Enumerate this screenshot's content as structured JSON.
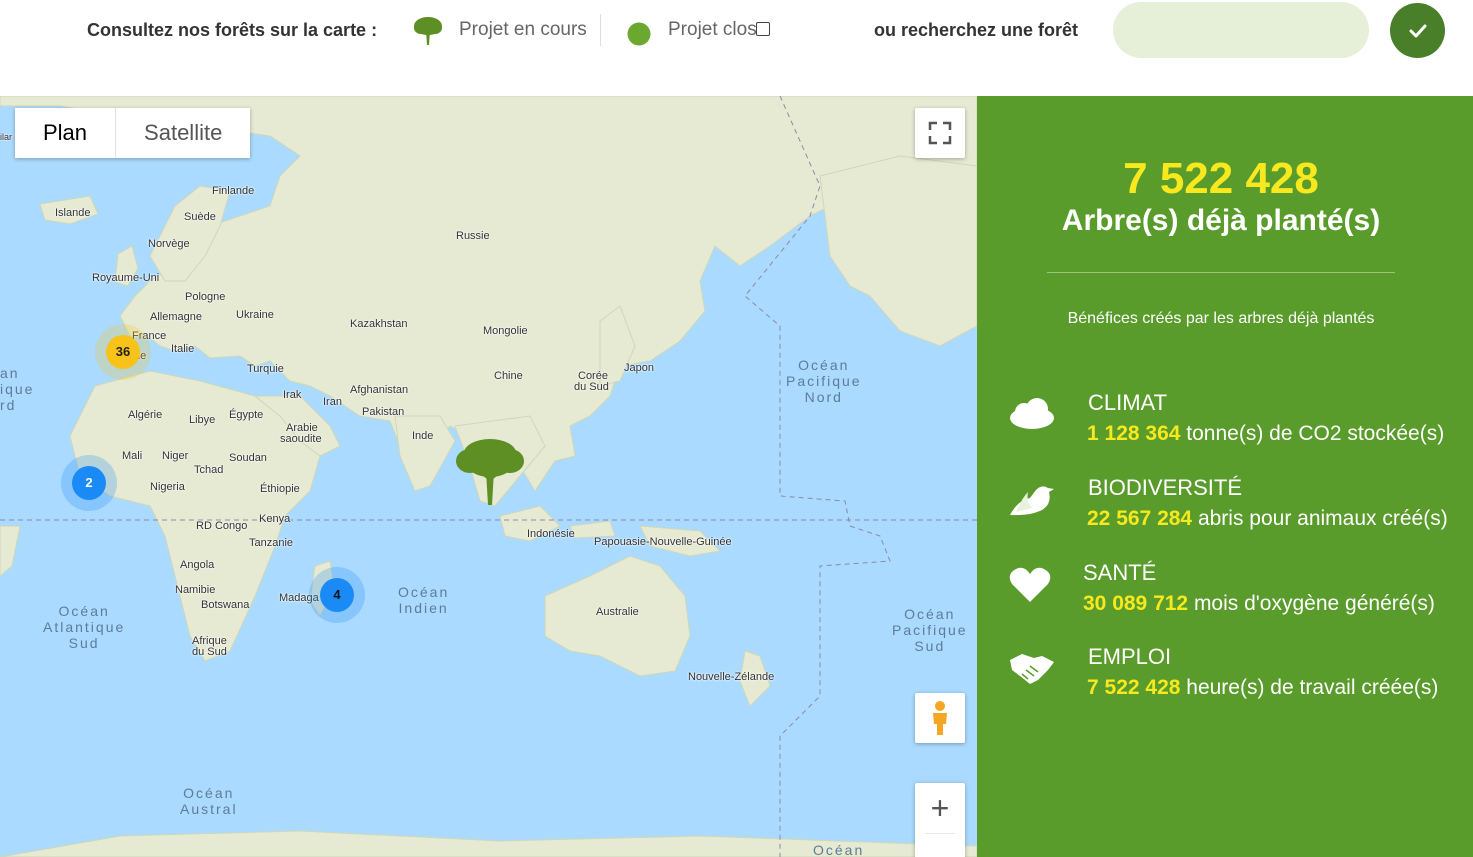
{
  "header": {
    "consult_label": "Consultez nos forêts sur la carte :",
    "legend_current": "Projet en cours",
    "legend_closed": "Projet clos",
    "search_label": "ou recherchez une forêt",
    "search_placeholder": "",
    "search_value": ""
  },
  "map": {
    "type_plan": "Plan",
    "type_satellite": "Satellite",
    "labels": {
      "finlande": "Finlande",
      "islande": "Islande",
      "suede": "Suède",
      "norvege": "Norvège",
      "royaume_uni": "Royaume-Uni",
      "pologne": "Pologne",
      "allemagne": "Allemagne",
      "ukraine": "Ukraine",
      "france": "France",
      "italie": "Italie",
      "espagne_partial": "ne",
      "turquie": "Turquie",
      "russie": "Russie",
      "kazakhstan": "Kazakhstan",
      "mongolie": "Mongolie",
      "chine": "Chine",
      "coree_du_sud_1": "Corée",
      "coree_du_sud_2": "du Sud",
      "japon": "Japon",
      "afghanistan": "Afghanistan",
      "irak": "Irak",
      "iran": "Iran",
      "pakistan": "Pakistan",
      "inde": "Inde",
      "algerie": "Algérie",
      "libye": "Libye",
      "egypte": "Égypte",
      "arabie_1": "Arabie",
      "arabie_2": "saoudite",
      "mali": "Mali",
      "niger": "Niger",
      "tchad": "Tchad",
      "soudan": "Soudan",
      "nigeria": "Nigeria",
      "ethiopie": "Éthiopie",
      "kenya": "Kenya",
      "rd_congo": "RD Congo",
      "tanzanie": "Tanzanie",
      "angola": "Angola",
      "namibie": "Namibie",
      "botswana": "Botswana",
      "madagascar_partial": "Madaga",
      "afrique_du_sud_1": "Afrique",
      "afrique_du_sud_2": "du Sud",
      "indonesie": "Indonésie",
      "papouasie": "Papouasie-Nouvelle-Guinée",
      "australie": "Australie",
      "nouvelle_zelande": "Nouvelle-Zélande",
      "left_edge_partial": "ilar"
    },
    "oceans": {
      "pacifique_nord": "Océan\nPacifique\nNord",
      "pacifique_sud": "Océan\nPacifique\nSud",
      "atlantique_sud": "Océan\nAtlantique\nSud",
      "indien": "Océan\nIndien",
      "austral": "Océan\nAustral",
      "atlantique_nord_partial": "an\nique\nrd",
      "bottom_right_partial": "Océan"
    },
    "clusters": [
      {
        "id": "europe",
        "count": "36",
        "color": "#f7c21a"
      },
      {
        "id": "west-africa",
        "count": "2",
        "color": "#1a8af7"
      },
      {
        "id": "madagascar",
        "count": "4",
        "color": "#1a8af7"
      }
    ],
    "controls": {
      "fullscreen": "fullscreen-icon",
      "pegman": "pegman-icon",
      "zoom_in": "+"
    }
  },
  "panel": {
    "trees_count": "7 522 428",
    "trees_label": "Arbre(s) déjà planté(s)",
    "benefits_caption": "Bénéfices créés par les arbres déjà plantés",
    "stats": [
      {
        "title": "CLIMAT",
        "value": "1 128 364",
        "text": " tonne(s) de CO2 stockée(s)",
        "icon": "cloud-icon"
      },
      {
        "title": "BIODIVERSITÉ",
        "value": "22 567 284",
        "text": " abris pour animaux créé(s)",
        "icon": "bird-icon"
      },
      {
        "title": "SANTÉ",
        "value": "30 089 712",
        "text": " mois d'oxygène généré(s)",
        "icon": "heart-icon"
      },
      {
        "title": "EMPLOI",
        "value": "7 522 428",
        "text": " heure(s) de travail créée(s)",
        "icon": "handshake-icon"
      }
    ]
  },
  "colors": {
    "panel_green": "#5a9c2b",
    "highlight_yellow": "#f8e81e",
    "search_bg": "#e6f0d8",
    "search_button": "#4a7f2a",
    "tree_green": "#5e8f24",
    "water": "#aadaff",
    "land": "#e8ecd9"
  }
}
